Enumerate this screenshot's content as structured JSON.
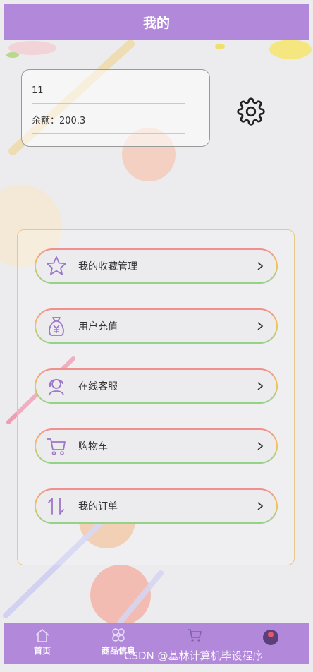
{
  "header": {
    "title": "我的"
  },
  "account": {
    "username": "11",
    "balance": "余额：200.3"
  },
  "menu": {
    "items": [
      {
        "label": "我的收藏管理",
        "icon": "star-icon"
      },
      {
        "label": "用户充值",
        "icon": "money-bag-icon"
      },
      {
        "label": "在线客服",
        "icon": "customer-service-icon"
      },
      {
        "label": "购物车",
        "icon": "shopping-cart-icon"
      },
      {
        "label": "我的订单",
        "icon": "sort-arrows-icon"
      }
    ]
  },
  "tabbar": {
    "items": [
      {
        "label": "首页",
        "icon": "home-icon"
      },
      {
        "label": "商品信息",
        "icon": "grid-icon"
      },
      {
        "label": "",
        "icon": "cart-icon"
      },
      {
        "label": "",
        "icon": "user-icon"
      }
    ]
  },
  "watermark": "CSDN @基林计算机毕设程序",
  "colors": {
    "accent": "#b188da",
    "background": "#ecebee",
    "icon": "#9c77c9"
  }
}
